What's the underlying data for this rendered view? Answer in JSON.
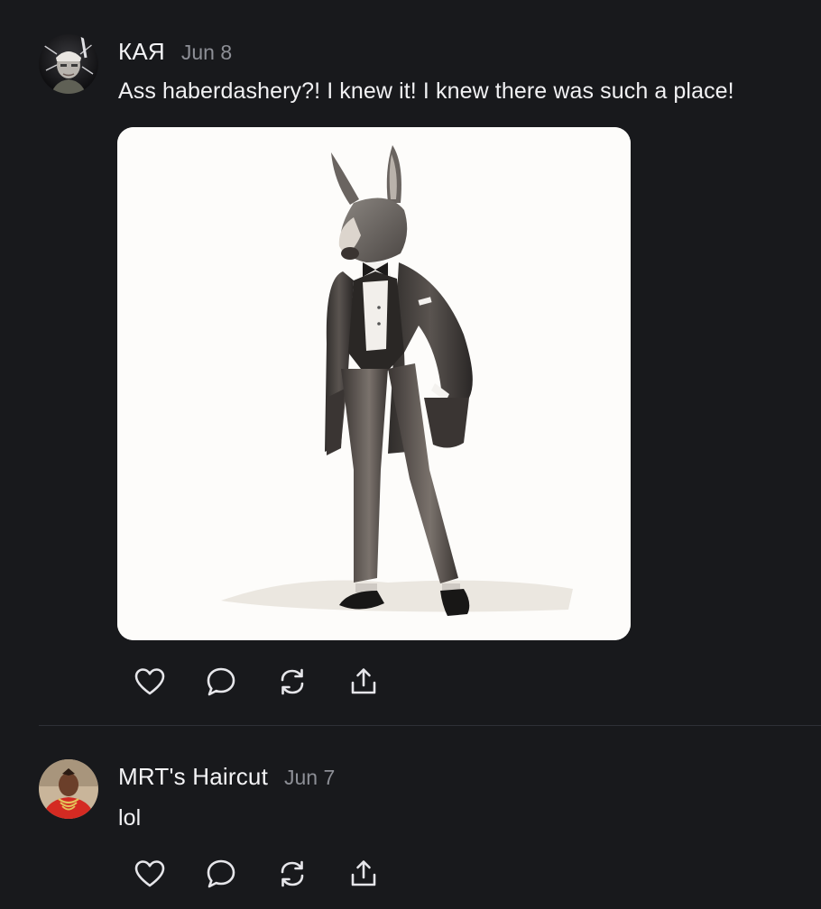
{
  "posts": [
    {
      "author": "КАЯ",
      "date": "Jun 8",
      "text": "Ass haberdashery?! I knew it! I knew there was such a place!",
      "has_image": true,
      "image_subject": "donkey-in-tuxedo-illustration"
    },
    {
      "author": "MRT's Haircut",
      "date": "Jun 7",
      "text": "lol",
      "has_image": false
    }
  ],
  "actions": {
    "icons": [
      "heart-icon",
      "comment-icon",
      "repost-icon",
      "share-icon"
    ]
  },
  "colors": {
    "background": "#18191c",
    "text": "#f1f1f3",
    "muted": "#8d8f96",
    "divider": "#2e3036",
    "icon": "#e6e6ea"
  }
}
